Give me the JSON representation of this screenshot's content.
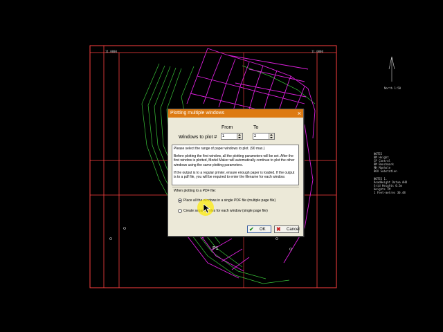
{
  "cad": {
    "top_left_label": "11.0000",
    "top_right_label": "11.0000",
    "north_arrow_label": "North 1:50",
    "parcel_label": "P1",
    "legend_block_1": "NOTES\nBM Height\nCP Control\nBM Benchmark\nMH Manhole\nBOX Substation",
    "legend_block_2": "NOTES 1.\nRoadHeight Datum AHD\nGrid Heights 0.5m\nHeights TM\n1 Feet-metres 30.48"
  },
  "dialog": {
    "title": "Plotting multiple windows",
    "close_symbol": "×",
    "from_label": "From",
    "to_label": "To",
    "windows_label": "Windows to plot #",
    "from_value": "1",
    "to_value": "2",
    "info_paragraphs": [
      "Please select the range of paper windows to plot. (90 max.)",
      "Before plotting the first window, all the plotting parameters will be set. After the first window is plotted, Model Maker will automatically continue to plot the other windows using the same plotting parameters.",
      "If the output is to a regular printer, ensure enough paper is loaded. If the output is to a pdf file, you will be required to enter the filename for each window."
    ],
    "pdf_group_label": "When plotting to a PDF file:",
    "option_single_label": "Place all the windows in a single PDF file (multiple page file)",
    "option_separate_label": "Create separate files for each window (single page file)",
    "selected_option": "single",
    "ok_label": "OK",
    "cancel_label": "Cancel"
  },
  "colors": {
    "title_bar": "#dd7a12",
    "cad_background": "#000000",
    "cad_magenta": "#e020e0",
    "cad_green": "#39c439",
    "cad_red": "#ff4040",
    "cursor_highlight": "#ffeb00"
  },
  "icons": {
    "ok_icon": "checkmark-icon",
    "cancel_icon": "x-mark-icon"
  }
}
